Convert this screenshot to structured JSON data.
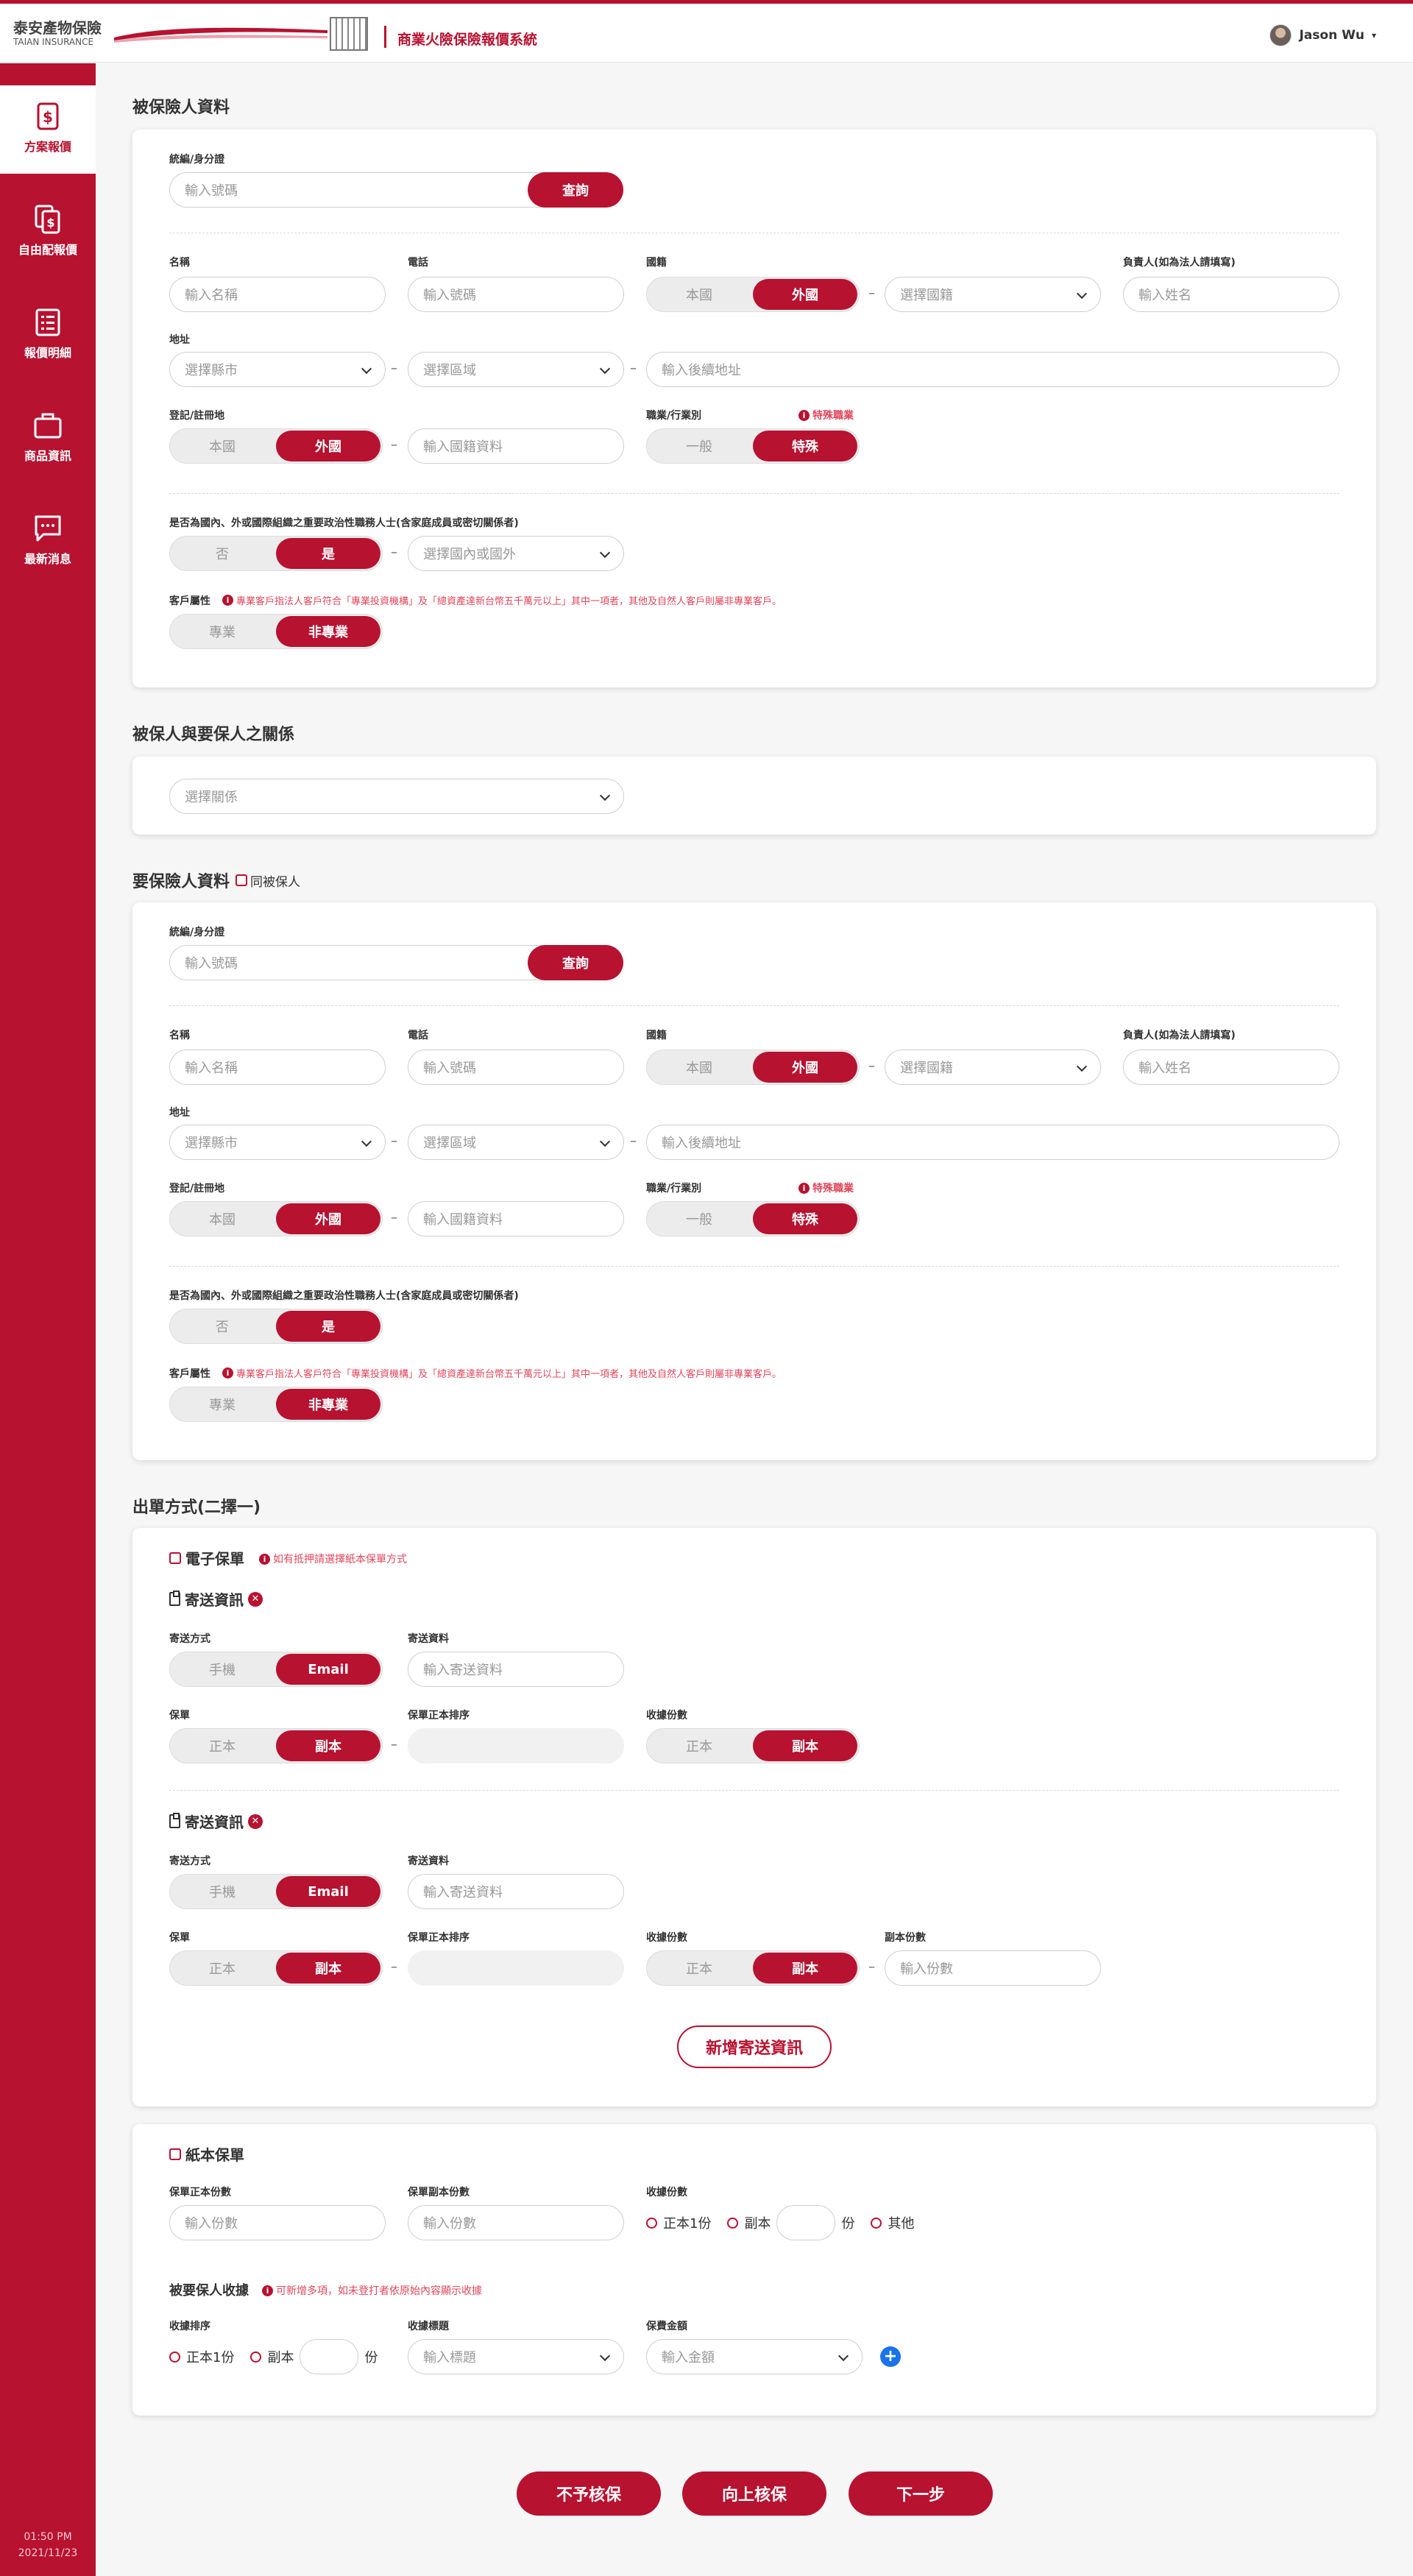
{
  "header": {
    "logo_zh": "泰安產物保險",
    "logo_en": "TAIAN INSURANCE",
    "system_title": "商業火險保險報價系統",
    "user_name": "Jason Wu",
    "user_caret": "▾"
  },
  "sidebar": {
    "items": [
      {
        "label": "方案報價",
        "icon": "dollar-document-icon"
      },
      {
        "label": "自由配報價",
        "icon": "copy-dollar-icon"
      },
      {
        "label": "報價明細",
        "icon": "list-icon"
      },
      {
        "label": "商品資訊",
        "icon": "briefcase-icon"
      },
      {
        "label": "最新消息",
        "icon": "chat-icon"
      }
    ],
    "time": "01:50 PM",
    "date": "2021/11/23"
  },
  "common": {
    "dash": "–",
    "id_label": "統編/身分證",
    "id_placeholder": "輸入號碼",
    "query": "查詢",
    "name_label": "名稱",
    "name_placeholder": "輸入名稱",
    "phone_label": "電話",
    "phone_placeholder": "輸入號碼",
    "nationality_label": "國籍",
    "domestic": "本國",
    "foreign": "外國",
    "select_nationality": "選擇國籍",
    "owner_label": "負責人(如為法人請填寫)",
    "owner_placeholder": "輸入姓名",
    "address_label": "地址",
    "select_city": "選擇縣市",
    "select_district": "選擇區域",
    "address_placeholder": "輸入後續地址",
    "registration_label": "登記/註冊地",
    "registration_placeholder": "輸入國籍資料",
    "occupation_label": "職業/行業別",
    "special_occupation_note": "特殊職業",
    "general": "一般",
    "special": "特殊",
    "pep_question": "是否為國內、外或國際組織之重要政治性職務人士(含家庭成員或密切關係者)",
    "no": "否",
    "yes": "是",
    "select_domestic_foreign": "選擇國內或國外",
    "customer_attr_label": "客戶屬性",
    "customer_attr_note": "專業客戶指法人客戶符合「專業投資機構」及「總資產達新台幣五千萬元以上」其中一項者，其他及自然人客戶則屬非專業客戶。",
    "professional": "專業",
    "non_professional": "非專業"
  },
  "sections": {
    "insured_title": "被保險人資料",
    "relation_title": "被保人與要保人之關係",
    "relation_placeholder": "選擇關係",
    "proposer_title": "要保險人資料",
    "same_as_insured": "同被保人",
    "issuance_title": "出單方式(二擇一)"
  },
  "issuance": {
    "electronic_label": "電子保單",
    "electronic_note": "如有抵押請選擇紙本保單方式",
    "delivery_info_title": "寄送資訊",
    "delivery_method_label": "寄送方式",
    "mobile": "手機",
    "email": "Email",
    "delivery_data_label": "寄送資料",
    "delivery_data_placeholder": "輸入寄送資料",
    "policy_label": "保單",
    "original": "正本",
    "copy": "副本",
    "original_order_label": "保單正本排序",
    "receipt_copies_label": "收據份數",
    "copy_count_label": "副本份數",
    "copy_count_placeholder": "輸入份數",
    "add_delivery": "新增寄送資訊",
    "paper_label": "紙本保單",
    "paper_original_count_label": "保單正本份數",
    "paper_copy_count_label": "保單副本份數",
    "count_placeholder": "輸入份數",
    "receipt_original_one": "正本1份",
    "receipt_copy": "副本",
    "unit": "份",
    "other": "其他",
    "proposer_receipt_title": "被要保人收據",
    "proposer_receipt_note": "可新增多項，如未登打者依原始內容顯示收據",
    "receipt_order_label": "收據排序",
    "receipt_title_label": "收據標題",
    "receipt_title_placeholder": "輸入標題",
    "premium_label": "保費金額",
    "premium_placeholder": "輸入金額"
  },
  "footer": {
    "reject": "不予核保",
    "escalate": "向上核保",
    "next": "下一步"
  },
  "colors": {
    "accent": "#b71230",
    "link_blue": "#1a73e8"
  }
}
